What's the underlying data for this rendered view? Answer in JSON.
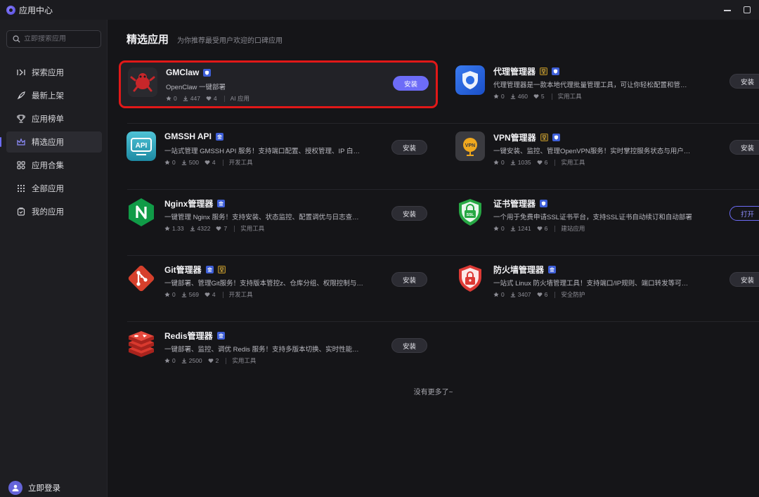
{
  "window": {
    "title": "应用中心"
  },
  "sidebar": {
    "search_placeholder": "立即搜索应用",
    "items": [
      {
        "label": "探索应用",
        "icon": "explore-icon",
        "active": false
      },
      {
        "label": "最新上架",
        "icon": "rocket-icon",
        "active": false
      },
      {
        "label": "应用榜单",
        "icon": "trophy-icon",
        "active": false
      },
      {
        "label": "精选应用",
        "icon": "crown-icon",
        "active": true
      },
      {
        "label": "应用合集",
        "icon": "collection-icon",
        "active": false
      },
      {
        "label": "全部应用",
        "icon": "grid-icon",
        "active": false
      },
      {
        "label": "我的应用",
        "icon": "my-apps-icon",
        "active": false
      }
    ],
    "login_label": "立即登录"
  },
  "header": {
    "title": "精选应用",
    "subtitle": "为你推荐最受用户欢迎的口碑应用"
  },
  "apps": [
    {
      "name": "GMClaw",
      "desc": "OpenClaw 一键部署",
      "rating": "0",
      "downloads": "447",
      "likes": "4",
      "category": "AI 应用",
      "button": "安装",
      "badges": [
        "blue"
      ]
    },
    {
      "name": "代理管理器",
      "desc": "代理管理器是一款本地代理批量管理工具，可让你轻松配置和管理系...",
      "rating": "0",
      "downloads": "460",
      "likes": "5",
      "category": "实用工具",
      "button": "安装",
      "badges": [
        "gold",
        "blue"
      ]
    },
    {
      "name": "GMSSH API",
      "desc": "一站式管理 GMSSH API 服务！支持端口配置、授权管理、IP 白名单...",
      "rating": "0",
      "downloads": "500",
      "likes": "4",
      "category": "开发工具",
      "button": "安装",
      "badges": [
        "blue"
      ]
    },
    {
      "name": "VPN管理器",
      "desc": "一键安装、监控、管理OpenVPN服务！实时掌控服务状态与用户连接...",
      "rating": "0",
      "downloads": "1035",
      "likes": "6",
      "category": "实用工具",
      "button": "安装",
      "badges": [
        "gold",
        "blue"
      ]
    },
    {
      "name": "Nginx管理器",
      "desc": "一键管理 Nginx 服务！支持安装、状态监控、配置调优与日志查看, ...",
      "rating": "1.33",
      "downloads": "4322",
      "likes": "7",
      "category": "实用工具",
      "button": "安装",
      "badges": [
        "blue"
      ]
    },
    {
      "name": "证书管理器",
      "desc": "一个用于免费申请SSL证书平台，支持SSL证书自动续订和自动部署",
      "rating": "0",
      "downloads": "1241",
      "likes": "6",
      "category": "建站应用",
      "button": "打开",
      "badges": [
        "blue"
      ]
    },
    {
      "name": "Git管理器",
      "desc": "一键部署、管理Git服务！支持版本管控z、仓库分组、权限控制与分...",
      "rating": "0",
      "downloads": "569",
      "likes": "4",
      "category": "开发工具",
      "button": "安装",
      "badges": [
        "blue",
        "gold"
      ]
    },
    {
      "name": "防火墙管理器",
      "desc": "一站式 Linux 防火墙管理工具！支持端口/IP规则、端口转发等可视化...",
      "rating": "0",
      "downloads": "3407",
      "likes": "6",
      "category": "安全防护",
      "button": "安装",
      "badges": [
        "blue"
      ]
    },
    {
      "name": "Redis管理器",
      "desc": "一键部署、监控、调优 Redis 服务！支持多版本切换、实时性能监控...",
      "rating": "0",
      "downloads": "2500",
      "likes": "2",
      "category": "实用工具",
      "button": "安装",
      "badges": [
        "blue"
      ]
    }
  ],
  "footer": {
    "no_more": "没有更多了~"
  },
  "colors": {
    "accent": "#6d6cf7",
    "highlight_border": "#e11818",
    "background": "#151518"
  }
}
